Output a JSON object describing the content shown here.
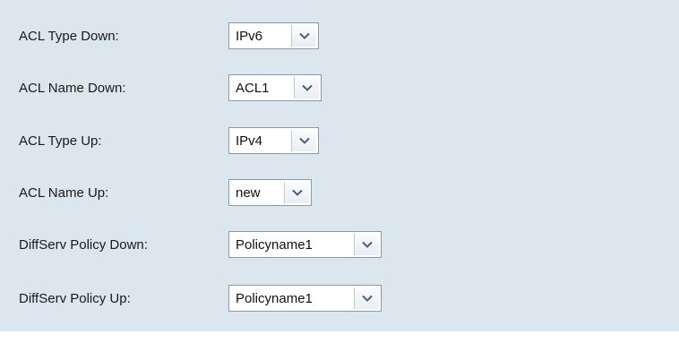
{
  "form": {
    "rows": [
      {
        "label": "ACL Type Down:",
        "value": "IPv6"
      },
      {
        "label": "ACL Name Down:",
        "value": "ACL1"
      },
      {
        "label": "ACL Type Up:",
        "value": "IPv4"
      },
      {
        "label": "ACL Name Up:",
        "value": "new"
      },
      {
        "label": "DiffServ Policy Down:",
        "value": "Policyname1"
      },
      {
        "label": "DiffServ Policy Up:",
        "value": "Policyname1"
      }
    ]
  },
  "colors": {
    "panel_background": "#dce6ef",
    "select_border": "#8a9aa9",
    "arrow_color": "#4a5f75"
  },
  "icons": {
    "dropdown": "chevron-down-icon"
  }
}
